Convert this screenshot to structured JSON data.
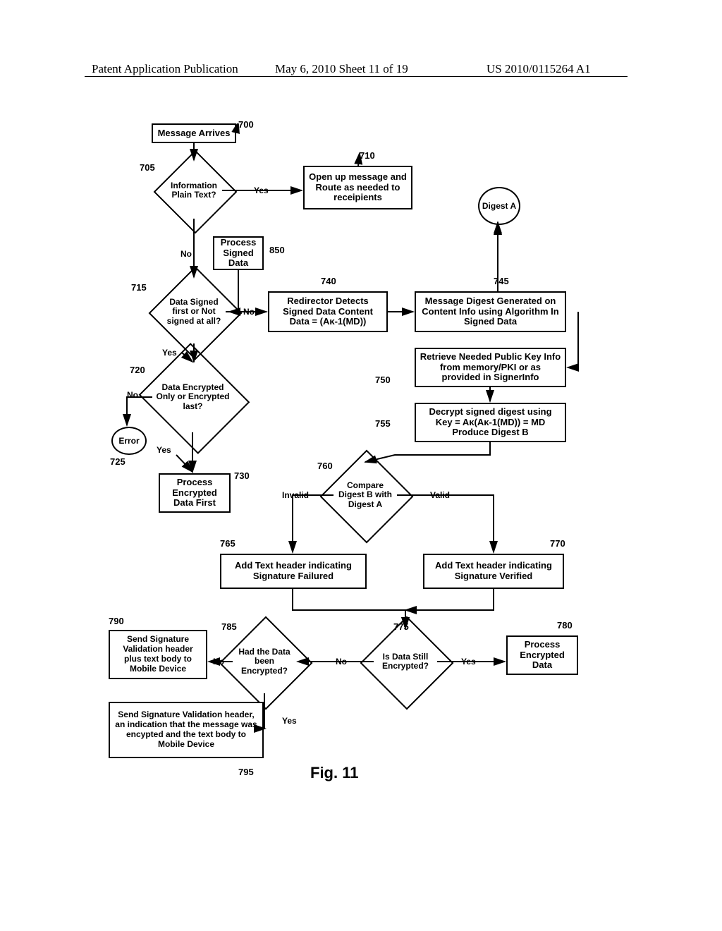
{
  "header": {
    "left": "Patent Application Publication",
    "center": "May 6, 2010  Sheet 11 of 19",
    "right": "US 2010/0115264 A1"
  },
  "figure_label": "Fig. 11",
  "refs": {
    "r700": "700",
    "r705": "705",
    "r710": "710",
    "r715": "715",
    "r720": "720",
    "r725": "725",
    "r730": "730",
    "r740": "740",
    "r745": "745",
    "r750": "750",
    "r755": "755",
    "r760": "760",
    "r765": "765",
    "r770": "770",
    "r775": "775",
    "r780": "780",
    "r785": "785",
    "r790": "790",
    "r795": "795",
    "r850": "850"
  },
  "nodes": {
    "n700": "Message Arrives",
    "n705": "Information Plain Text?",
    "n710": "Open up message and Route as needed to receipients",
    "n850": "Process Signed Data",
    "n715": "Data Signed first or Not signed at all?",
    "n740": "Redirector Detects Signed Data Content Data = (Aᴋ-1(MD))",
    "n745": "Message Digest Generated on Content Info using Algorithm In Signed Data",
    "n720": "Data Encrypted Only or Encrypted last?",
    "n750": "Retrieve Needed Public Key Info from memory/PKI or as provided in SignerInfo",
    "n755": "Decrypt signed digest using Key = Aᴋ(Aᴋ-1(MD)) = MD Produce Digest B",
    "n760": "Compare Digest B with Digest A",
    "n730": "Process Encrypted Data First",
    "n765": "Add Text header indicating Signature Failured",
    "n770": "Add Text header indicating Signature Verified",
    "n775": "Is Data Still Encrypted?",
    "n780": "Process Encrypted Data",
    "n785": "Had the Data been Encrypted?",
    "n790": "Send Signature Validation header plus text body to Mobile Device",
    "n795": "Send Signature Validation header, an indication that the message was encypted and the text body to Mobile Device",
    "digestA": "Digest A",
    "error": "Error"
  },
  "labels": {
    "yes": "Yes",
    "no": "No",
    "valid": "Valid",
    "invalid": "Invalid"
  }
}
